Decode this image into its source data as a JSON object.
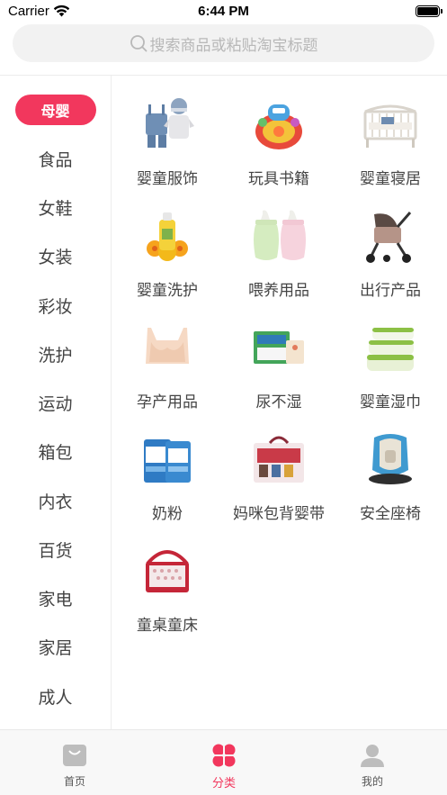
{
  "status_bar": {
    "carrier": "Carrier",
    "time": "6:44 PM"
  },
  "search": {
    "placeholder": "搜索商品或粘贴淘宝标题"
  },
  "sidebar": {
    "items": [
      {
        "label": "母婴",
        "active": true
      },
      {
        "label": "食品"
      },
      {
        "label": "女鞋"
      },
      {
        "label": "女装"
      },
      {
        "label": "彩妆"
      },
      {
        "label": "洗护"
      },
      {
        "label": "运动"
      },
      {
        "label": "箱包"
      },
      {
        "label": "内衣"
      },
      {
        "label": "百货"
      },
      {
        "label": "家电"
      },
      {
        "label": "家居"
      },
      {
        "label": "成人"
      }
    ]
  },
  "categories": [
    {
      "label": "婴童服饰",
      "icon": "baby-clothes-icon"
    },
    {
      "label": "玩具书籍",
      "icon": "toy-icon"
    },
    {
      "label": "婴童寝居",
      "icon": "crib-icon"
    },
    {
      "label": "婴童洗护",
      "icon": "baby-wash-icon"
    },
    {
      "label": "喂养用品",
      "icon": "feeding-bottle-icon"
    },
    {
      "label": "出行产品",
      "icon": "stroller-icon"
    },
    {
      "label": "孕产用品",
      "icon": "maternity-bra-icon"
    },
    {
      "label": "尿不湿",
      "icon": "diaper-icon"
    },
    {
      "label": "婴童湿巾",
      "icon": "wet-wipes-icon"
    },
    {
      "label": "奶粉",
      "icon": "milk-powder-icon"
    },
    {
      "label": "妈咪包背婴带",
      "icon": "diaper-bag-icon"
    },
    {
      "label": "安全座椅",
      "icon": "car-seat-icon"
    },
    {
      "label": "童桌童床",
      "icon": "play-yard-icon"
    }
  ],
  "tabbar": {
    "tabs": [
      {
        "label": "首页",
        "icon": "home-bag-icon"
      },
      {
        "label": "分类",
        "icon": "category-clover-icon",
        "active": true
      },
      {
        "label": "我的",
        "icon": "profile-icon"
      }
    ]
  },
  "colors": {
    "accent": "#f2375d",
    "tab_inactive": "#bdbdbd"
  }
}
